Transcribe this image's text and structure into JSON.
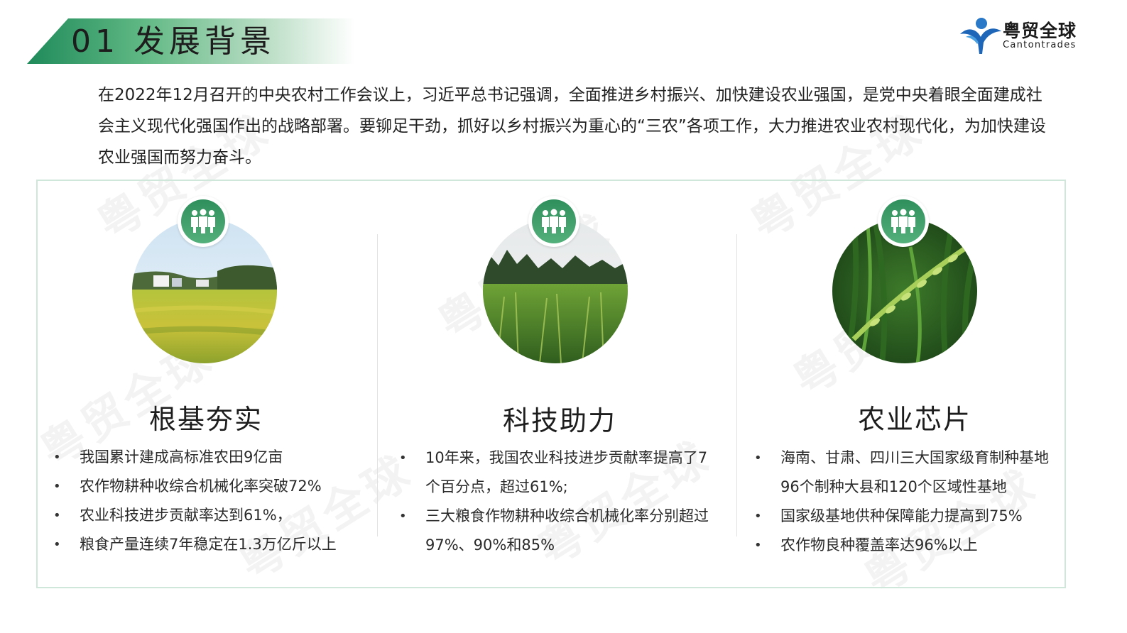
{
  "header": {
    "title": "01  发展背景",
    "brand_color": "#2f8f5c"
  },
  "logo": {
    "name": "粤贸全球",
    "english": "Cantontrades"
  },
  "intro": {
    "text": "在2022年12月召开的中央农村工作会议上，习近平总书记强调，全面推进乡村振兴、加快建设农业强国，是党中央着眼全面建成社会主义现代化强国作出的战略部署。要铆足干劲，抓好以乡村振兴为重心的“三农”各项工作，大力推进农业农村现代化，为加快建设农业强国而努力奋斗。"
  },
  "watermark": "粤贸全球",
  "columns": [
    {
      "title": "根基夯实",
      "icon": "team-icon",
      "image": "rice-field-village",
      "bullets": [
        "我国累计建成高标准农田9亿亩",
        "农作物耕种收综合机械化率突破72%",
        "农业科技进步贡献率达到61%，",
        "粮食产量连续7年稳定在1.3万亿斤以上"
      ]
    },
    {
      "title": "科技助力",
      "icon": "team-icon",
      "image": "rice-paddy-closeup",
      "bullets": [
        "10年来，我国农业科技进步贡献率提高了7个百分点，超过61%;",
        "三大粮食作物耕种收综合机械化率分别超过97%、90%和85%"
      ]
    },
    {
      "title": "农业芯片",
      "icon": "team-icon",
      "image": "rice-ear-macro",
      "bullets": [
        "海南、甘肃、四川三大国家级育制种基地96个制种大县和120个区域性基地",
        "国家级基地供种保障能力提高到75%",
        "农作物良种覆盖率达96%以上"
      ]
    }
  ]
}
